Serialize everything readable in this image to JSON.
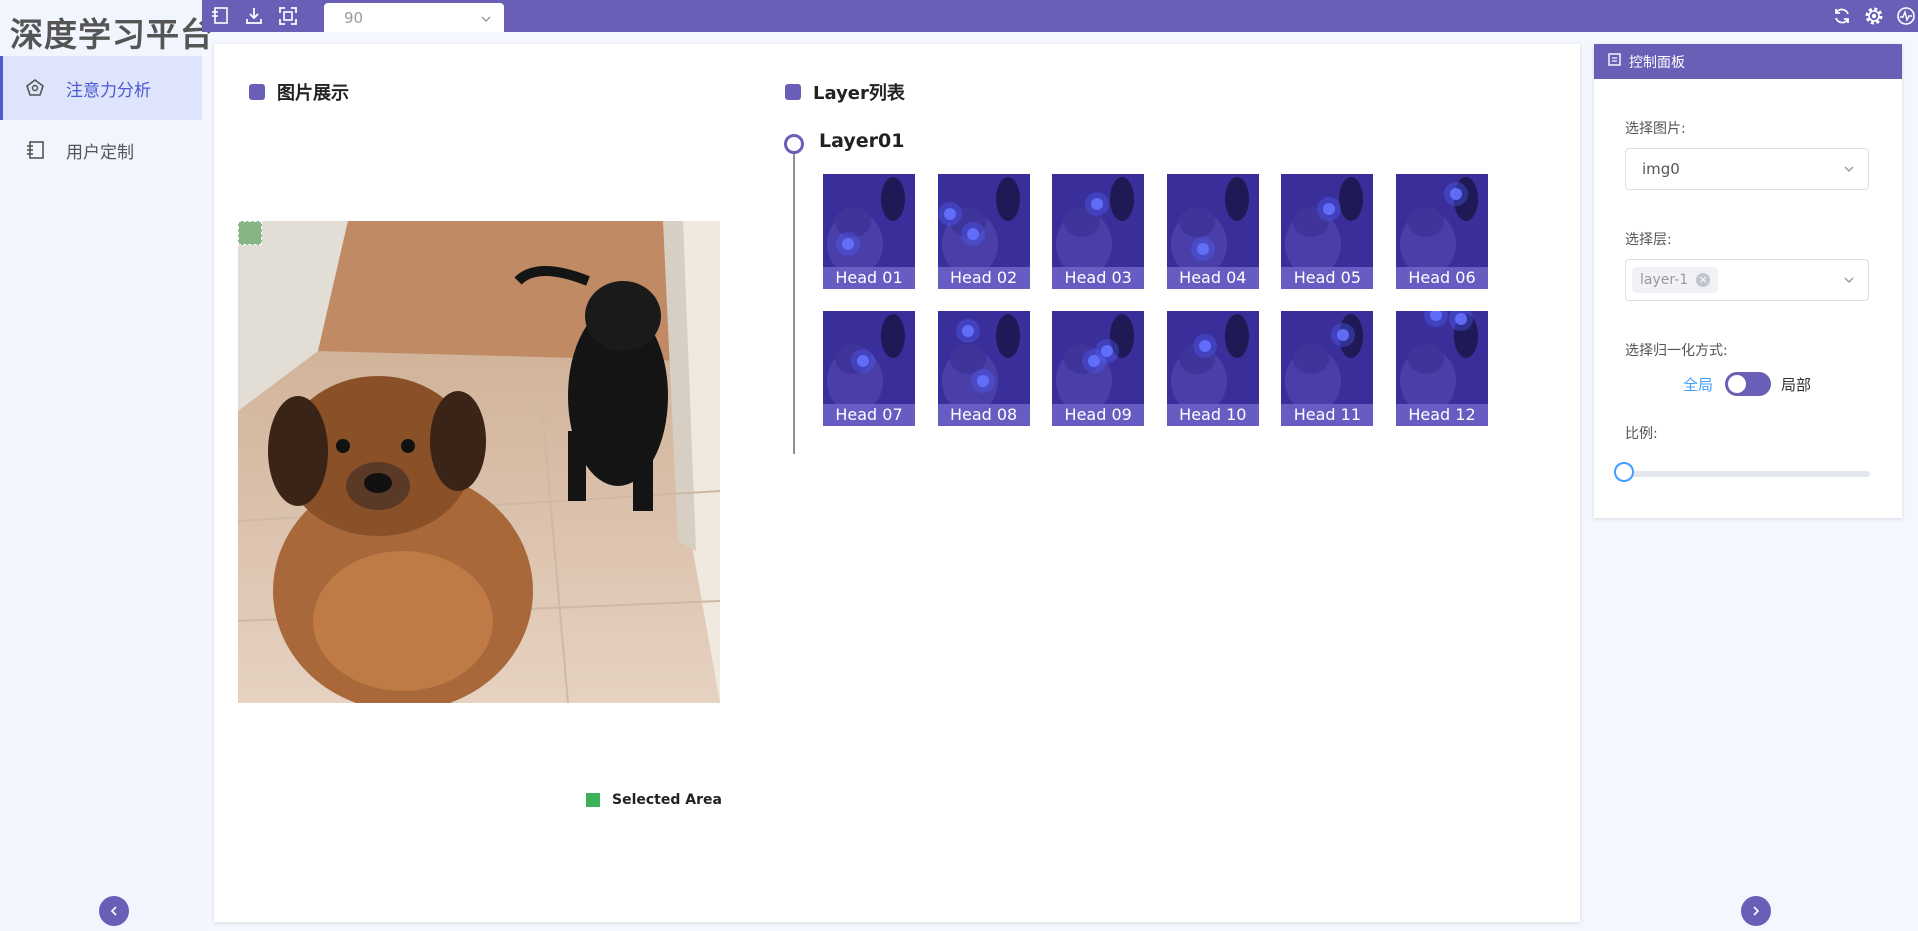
{
  "app": {
    "title": "深度学习平台"
  },
  "sidebar": {
    "items": [
      {
        "label": "注意力分析",
        "icon": "attention-icon",
        "active": true
      },
      {
        "label": "用户定制",
        "icon": "user-custom-icon",
        "active": false
      }
    ]
  },
  "toolbar": {
    "select_value": "90",
    "icons": [
      "import-icon",
      "download-icon",
      "fullscreen-icon",
      "refresh-icon",
      "settings-icon",
      "monitor-icon"
    ]
  },
  "image_panel": {
    "title": "图片展示",
    "legend_label": "Selected Area"
  },
  "layer_panel": {
    "title": "Layer列表",
    "layer_name": "Layer01",
    "heads": [
      "Head 01",
      "Head 02",
      "Head 03",
      "Head 04",
      "Head 05",
      "Head 06",
      "Head 07",
      "Head 08",
      "Head 09",
      "Head 10",
      "Head 11",
      "Head 12"
    ]
  },
  "control_panel": {
    "title": "控制面板",
    "image_label": "选择图片:",
    "image_value": "img0",
    "layer_label": "选择层:",
    "layer_tag": "layer-1",
    "norm_label": "选择归一化方式:",
    "norm_left": "全局",
    "norm_right": "局部",
    "ratio_label": "比例:",
    "ratio_value": 0
  },
  "colors": {
    "accent": "#6a5fb7",
    "active_nav": "#4d5bd0",
    "selected_area": "#3cb35a",
    "link_blue": "#409eff"
  }
}
